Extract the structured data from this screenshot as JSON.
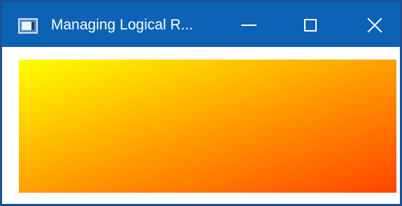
{
  "window": {
    "title": "Managing Logical R...",
    "icon": "app-window-icon",
    "controls": {
      "minimize_icon": "minimize-icon",
      "maximize_icon": "maximize-icon",
      "close_icon": "close-icon"
    },
    "titlebar_color": "#0d62b5",
    "border_color": "#1a4f9a"
  },
  "content": {
    "gradient": {
      "direction": "to bottom right",
      "start_color": "#ffff00",
      "end_color": "#ff4500"
    }
  }
}
